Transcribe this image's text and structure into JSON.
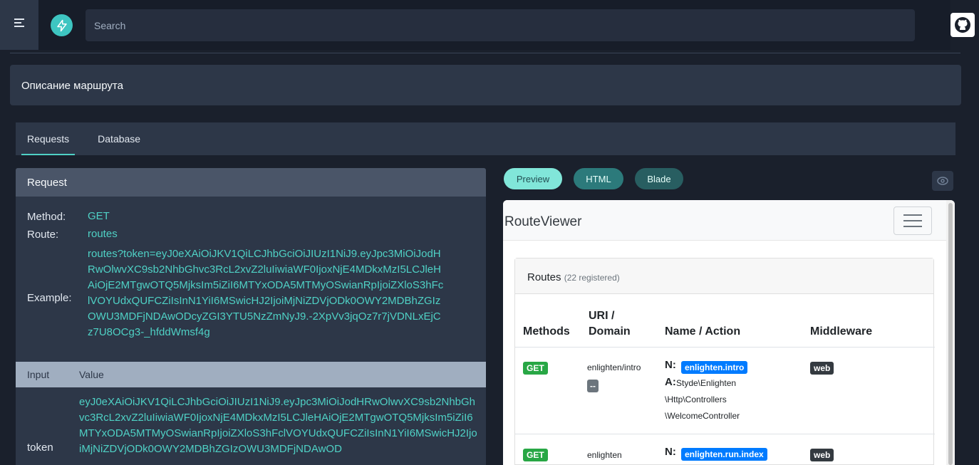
{
  "topbar": {
    "search_placeholder": "Search",
    "icons": [
      "menu-icon",
      "bolt-icon",
      "github-icon"
    ]
  },
  "page": {
    "title": "Описание маршрута"
  },
  "tabs": [
    {
      "label": "Requests",
      "active": true
    },
    {
      "label": "Database",
      "active": false
    }
  ],
  "request": {
    "header": "Request",
    "method_label": "Method:",
    "method_value": "GET",
    "route_label": "Route:",
    "route_value": "routes",
    "example_label": "Example:",
    "example_lines": [
      "routes?token=eyJ0eXAiOiJKV1QiLCJhbGciOiJIUzI1NiJ9.eyJpc3MiOiJodH",
      "RwOlwvXC9sb2NhbGhvc3RcL2xvZ2luIiwiaWF0IjoxNjE4MDkxMzI5LCJleH",
      "AiOjE2MTgwOTQ5MjksIm5iZiI6MTYxODA5MTMyOSwianRpIjoiZXloS3hFc",
      "lVOYUdxQUFCZiIsInN1YiI6MSwicHJ2IjoiMjNiZDVjODk0OWY2MDBhZGIz",
      "OWU3MDFjNDAwODcyZGI3YTU5NzZmNyJ9.-2XpVv3jqOz7r7jVDNLxEjC",
      "z7U8OCg3-_hfddWmsf4g"
    ],
    "input_header": "Input",
    "value_header": "Value",
    "token_name": "token",
    "token_value": "eyJ0eXAiOiJKV1QiLCJhbGciOiJIUzI1NiJ9.eyJpc3MiOiJodHRwOlwvXC9sb2NhbGhvc3RcL2xvZ2luIiwiaWF0IjoxNjE4MDkxMzI5LCJleHAiOjE2MTgwOTQ5MjksIm5iZiI6MTYxODA5MTMyOSwianRpIjoiZXloS3hFclVOYUdxQUFCZiIsInN1YiI6MSwicHJ2IjoiMjNiZDVjODk0OWY2MDBhZGIzOWU3MDFjNDAwOD"
  },
  "preview_tabs": [
    "Preview",
    "HTML",
    "Blade"
  ],
  "preview": {
    "brand": "RouteViewer",
    "card_title": "Routes",
    "card_count": "(22 registered)",
    "columns": {
      "methods": "Methods",
      "uri_line1": "URI /",
      "uri_line2": "Domain",
      "name": "Name / Action",
      "middleware": "Middleware"
    },
    "rows": [
      {
        "method": "GET",
        "uri": "enlighten/intro",
        "domain_badge": "--",
        "name_prefix": "N:",
        "name": "enlighten.intro",
        "action_prefix": "A:",
        "action_lines": [
          "Styde\\Enlighten",
          "\\Http\\Controllers",
          "\\WelcomeController"
        ],
        "middleware": "web"
      },
      {
        "method": "GET",
        "uri": "enlighten",
        "name_prefix": "N:",
        "name": "enlighten.run.index",
        "middleware": "web"
      }
    ]
  }
}
